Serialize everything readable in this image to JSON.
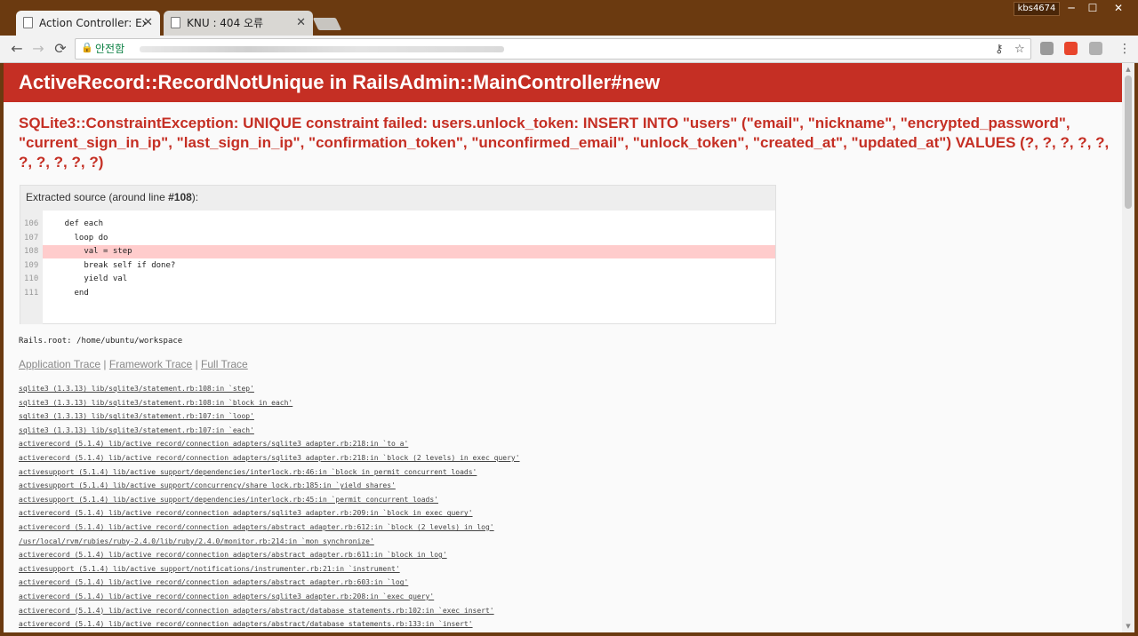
{
  "tabs": [
    {
      "title": "Action Controller: Excep",
      "active": true
    },
    {
      "title": "KNU : 404 오류",
      "active": false
    }
  ],
  "window": {
    "user": "kbs4674",
    "minimize": "─",
    "maximize": "☐",
    "close": "✕"
  },
  "toolbar": {
    "back": "←",
    "forward": "→",
    "reload": "⟳",
    "secure_label": "안전함",
    "key_icon": "⚷",
    "star_icon": "☆",
    "menu_icon": "⋮"
  },
  "error": {
    "title": "ActiveRecord::RecordNotUnique in RailsAdmin::MainController#new",
    "message": "SQLite3::ConstraintException: UNIQUE constraint failed: users.unlock_token: INSERT INTO \"users\" (\"email\", \"nickname\", \"encrypted_password\", \"current_sign_in_ip\", \"last_sign_in_ip\", \"confirmation_token\", \"unconfirmed_email\", \"unlock_token\", \"created_at\", \"updated_at\") VALUES (?, ?, ?, ?, ?, ?, ?, ?, ?, ?)"
  },
  "source": {
    "header_prefix": "Extracted source (around line ",
    "header_line": "#108",
    "header_suffix": "):",
    "lines": [
      {
        "num": "106",
        "code": "    def each",
        "highlight": false
      },
      {
        "num": "107",
        "code": "      loop do",
        "highlight": false
      },
      {
        "num": "108",
        "code": "        val = step",
        "highlight": true
      },
      {
        "num": "109",
        "code": "        break self if done?",
        "highlight": false
      },
      {
        "num": "110",
        "code": "        yield val",
        "highlight": false
      },
      {
        "num": "111",
        "code": "      end",
        "highlight": false
      }
    ]
  },
  "rails_root": "Rails.root: /home/ubuntu/workspace",
  "trace_links": {
    "application": "Application Trace",
    "framework": "Framework Trace",
    "full": "Full Trace",
    "separator": "|"
  },
  "trace": [
    "sqlite3 (1.3.13) lib/sqlite3/statement.rb:108:in `step'",
    "sqlite3 (1.3.13) lib/sqlite3/statement.rb:108:in `block in each'",
    "sqlite3 (1.3.13) lib/sqlite3/statement.rb:107:in `loop'",
    "sqlite3 (1.3.13) lib/sqlite3/statement.rb:107:in `each'",
    "activerecord (5.1.4) lib/active_record/connection_adapters/sqlite3_adapter.rb:218:in `to_a'",
    "activerecord (5.1.4) lib/active_record/connection_adapters/sqlite3_adapter.rb:218:in `block (2 levels) in exec_query'",
    "activesupport (5.1.4) lib/active_support/dependencies/interlock.rb:46:in `block in permit_concurrent_loads'",
    "activesupport (5.1.4) lib/active_support/concurrency/share_lock.rb:185:in `yield_shares'",
    "activesupport (5.1.4) lib/active_support/dependencies/interlock.rb:45:in `permit_concurrent_loads'",
    "activerecord (5.1.4) lib/active_record/connection_adapters/sqlite3_adapter.rb:209:in `block in exec_query'",
    "activerecord (5.1.4) lib/active_record/connection_adapters/abstract_adapter.rb:612:in `block (2 levels) in log'",
    "/usr/local/rvm/rubies/ruby-2.4.0/lib/ruby/2.4.0/monitor.rb:214:in `mon_synchronize'",
    "activerecord (5.1.4) lib/active_record/connection_adapters/abstract_adapter.rb:611:in `block in log'",
    "activesupport (5.1.4) lib/active_support/notifications/instrumenter.rb:21:in `instrument'",
    "activerecord (5.1.4) lib/active_record/connection_adapters/abstract_adapter.rb:603:in `log'",
    "activerecord (5.1.4) lib/active_record/connection_adapters/sqlite3_adapter.rb:208:in `exec_query'",
    "activerecord (5.1.4) lib/active_record/connection_adapters/abstract/database_statements.rb:102:in `exec_insert'",
    "activerecord (5.1.4) lib/active_record/connection_adapters/abstract/database_statements.rb:133:in `insert'"
  ],
  "colors": {
    "frame": "#6b3a10",
    "header_red": "#c52f24",
    "highlight": "#ffcccc",
    "secure_green": "#0b8043"
  }
}
